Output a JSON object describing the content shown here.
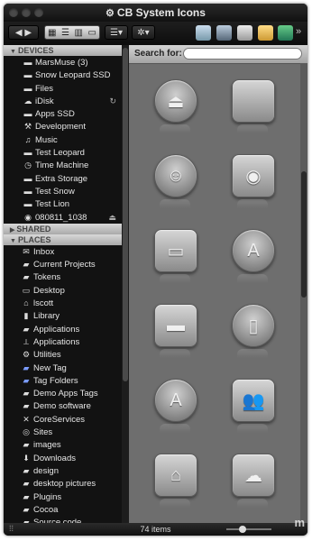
{
  "window": {
    "title": "CB System Icons"
  },
  "toolbar": {
    "chevron": "»"
  },
  "sidebar": {
    "devices_header": "DEVICES",
    "shared_header": "SHARED",
    "places_header": "PLACES",
    "devices": [
      {
        "label": "MarsMuse (3)",
        "icon": "drive-icon"
      },
      {
        "label": "Snow Leopard SSD",
        "icon": "drive-icon"
      },
      {
        "label": "Files",
        "icon": "drive-icon"
      },
      {
        "label": "iDisk",
        "icon": "cloud-icon",
        "extra": "↻"
      },
      {
        "label": "Apps SSD",
        "icon": "drive-icon"
      },
      {
        "label": "Development",
        "icon": "tool-icon"
      },
      {
        "label": "Music",
        "icon": "music-icon"
      },
      {
        "label": "Test Leopard",
        "icon": "drive-icon"
      },
      {
        "label": "Time Machine",
        "icon": "clock-icon"
      },
      {
        "label": "Extra Storage",
        "icon": "drive-icon"
      },
      {
        "label": "Test Snow",
        "icon": "drive-icon"
      },
      {
        "label": "Test Lion",
        "icon": "drive-icon"
      },
      {
        "label": "080811_1038",
        "icon": "disc-icon",
        "extra": "⏏"
      }
    ],
    "places": [
      {
        "label": "Inbox",
        "icon": "inbox-icon"
      },
      {
        "label": "Current Projects",
        "icon": "folder-icon"
      },
      {
        "label": "Tokens",
        "icon": "folder-icon"
      },
      {
        "label": "Desktop",
        "icon": "desktop-icon"
      },
      {
        "label": "lscott",
        "icon": "home-icon"
      },
      {
        "label": "Library",
        "icon": "library-icon"
      },
      {
        "label": "Applications",
        "icon": "folder-icon"
      },
      {
        "label": "Applications",
        "icon": "apps-icon"
      },
      {
        "label": "Utilities",
        "icon": "utilities-icon"
      },
      {
        "label": "New Tag",
        "icon": "tag-folder-icon"
      },
      {
        "label": "Tag Folders",
        "icon": "tag-folder-icon"
      },
      {
        "label": "Demo Apps Tags",
        "icon": "folder-icon"
      },
      {
        "label": "Demo software",
        "icon": "folder-icon"
      },
      {
        "label": "CoreServices",
        "icon": "x-icon"
      },
      {
        "label": "Sites",
        "icon": "globe-icon"
      },
      {
        "label": "images",
        "icon": "folder-icon"
      },
      {
        "label": "Downloads",
        "icon": "download-icon"
      },
      {
        "label": "design",
        "icon": "folder-icon"
      },
      {
        "label": "desktop pictures",
        "icon": "folder-icon"
      },
      {
        "label": "Plugins",
        "icon": "folder-icon"
      },
      {
        "label": "Cocoa",
        "icon": "folder-icon"
      },
      {
        "label": "Source code",
        "icon": "folder-icon"
      }
    ]
  },
  "search": {
    "label": "Search for:",
    "value": ""
  },
  "icons": [
    {
      "name": "eject-icon",
      "shape": "round",
      "glyph": "⏏"
    },
    {
      "name": "blank-square-icon",
      "shape": "square",
      "glyph": ""
    },
    {
      "name": "finder-icon",
      "shape": "round",
      "glyph": "☺"
    },
    {
      "name": "wifi-icon",
      "shape": "square",
      "glyph": "◉"
    },
    {
      "name": "folder-icon",
      "shape": "square",
      "glyph": "▭"
    },
    {
      "name": "app-store-icon",
      "shape": "round",
      "glyph": "A"
    },
    {
      "name": "drive-icon",
      "shape": "square",
      "glyph": "▬"
    },
    {
      "name": "document-icon",
      "shape": "round",
      "glyph": "▯"
    },
    {
      "name": "font-icon",
      "shape": "round",
      "glyph": "A"
    },
    {
      "name": "users-icon",
      "shape": "square",
      "glyph": "👥"
    },
    {
      "name": "home-icon",
      "shape": "square",
      "glyph": "⌂"
    },
    {
      "name": "cloud-icon",
      "shape": "square",
      "glyph": "☁"
    }
  ],
  "status": {
    "count": "74 items"
  },
  "watermark": "m"
}
